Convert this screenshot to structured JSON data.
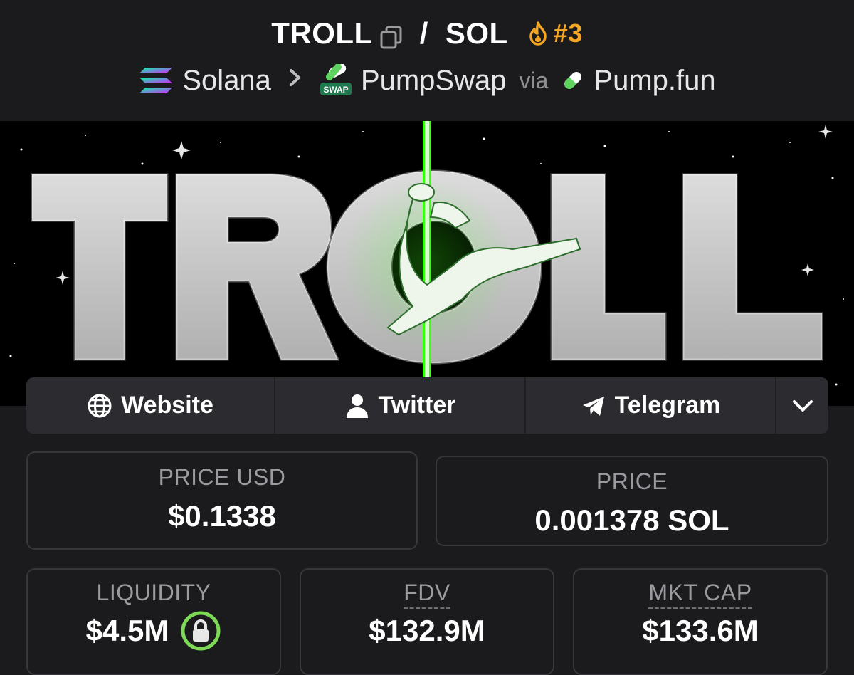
{
  "header": {
    "base_token": "TROLL",
    "separator": "/",
    "quote_token": "SOL",
    "rank": "#3",
    "chain": "Solana",
    "dex": "PumpSwap",
    "dex_badge": "SWAP",
    "via": "via",
    "launchpad": "Pump.fun"
  },
  "banner": {
    "text": "TROLL"
  },
  "links": {
    "website": "Website",
    "twitter": "Twitter",
    "telegram": "Telegram"
  },
  "stats": {
    "price_usd_label": "PRICE USD",
    "price_usd": "$0.1338",
    "price_label": "PRICE",
    "price": "0.001378 SOL",
    "liquidity_label": "LIQUIDITY",
    "liquidity": "$4.5M",
    "fdv_label": "FDV",
    "fdv": "$132.9M",
    "mktcap_label": "MKT CAP",
    "mktcap": "$133.6M"
  },
  "colors": {
    "rank": "#f5a623",
    "lock": "#7ed957",
    "pole": "#39ff14"
  }
}
